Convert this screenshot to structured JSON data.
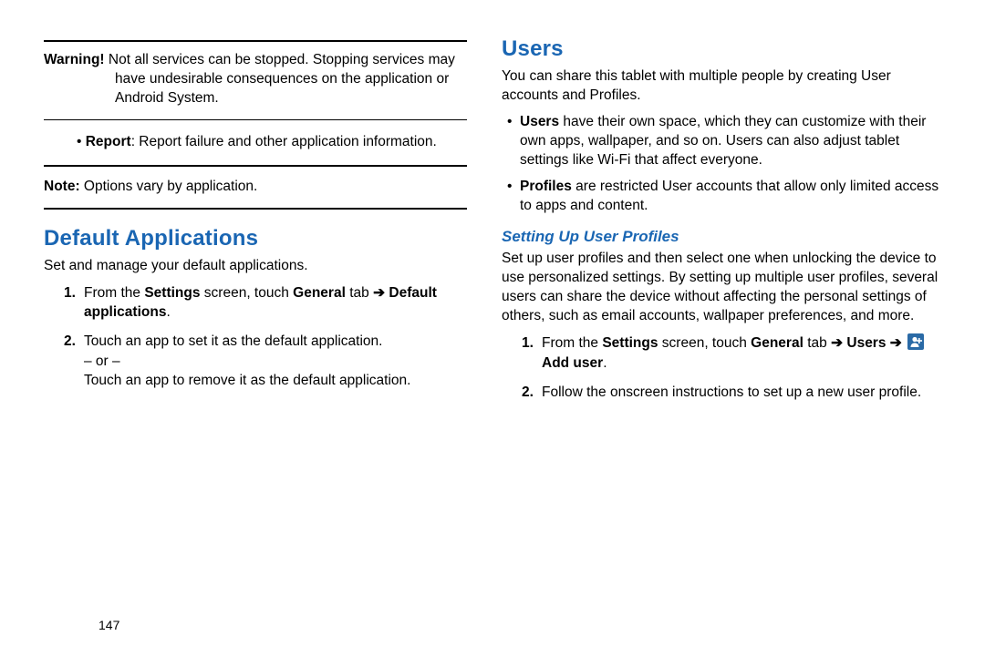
{
  "left": {
    "warning": {
      "label": "Warning!",
      "text": "Not all services can be stopped. Stopping services may have undesirable consequences on the application or Android System."
    },
    "report": {
      "label": "Report",
      "text": ": Report failure and other application information."
    },
    "note": {
      "label": "Note:",
      "text": "Options vary by application."
    },
    "section_title": "Default Applications",
    "section_intro": "Set and manage your default applications.",
    "step1": {
      "pre": "From the ",
      "b1": "Settings",
      "mid1": " screen, touch ",
      "b2": "General",
      "mid2": " tab ",
      "arrow": "➔",
      "b3": "Default applications",
      "post": "."
    },
    "step2_line1": "Touch an app to set it as the default application.",
    "step2_or": "– or –",
    "step2_line2": "Touch an app to remove it as the default application."
  },
  "right": {
    "section_title": "Users",
    "section_intro": "You can share this tablet with multiple people by creating User accounts and Profiles.",
    "bullet1": {
      "label": "Users",
      "text": " have their own space, which they can customize with their own apps, wallpaper, and so on. Users can also adjust tablet settings like Wi-Fi that affect everyone."
    },
    "bullet2": {
      "label": "Profiles",
      "text": " are restricted User accounts that allow only limited access to apps and content."
    },
    "sub_title": "Setting Up User Profiles",
    "sub_intro": "Set up user profiles and then select one when unlocking the device to use personalized settings. By setting up multiple user profiles, several users can share the device without affecting the personal settings of others, such as email accounts, wallpaper preferences, and more.",
    "step1": {
      "pre": "From the ",
      "b1": "Settings",
      "mid1": " screen, touch ",
      "b2": "General",
      "mid2": " tab ",
      "arrow1": "➔",
      "b3": "Users",
      "arrow2": "➔",
      "b4": "Add user",
      "post": "."
    },
    "step2": "Follow the onscreen instructions to set up a new user profile."
  },
  "page_number": "147"
}
